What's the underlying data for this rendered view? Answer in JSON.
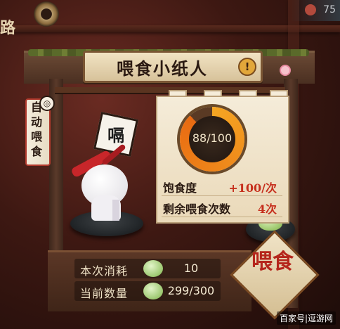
{
  "hud": {
    "corner_text": "路",
    "top_right_number": "75"
  },
  "panel": {
    "title": "喂食小纸人",
    "info_label": "!"
  },
  "auto_feed": {
    "label_chars": [
      "自",
      "动",
      "喂",
      "食"
    ]
  },
  "speech": {
    "text": "嗝"
  },
  "satiety": {
    "current": 88,
    "max": 100,
    "display": "88/100",
    "fraction": 0.88
  },
  "stats": {
    "satiety_label": "饱食度",
    "satiety_gain": "+100/次",
    "remaining_label": "剩余喂食次数",
    "remaining_value": "4次"
  },
  "cost": {
    "this_time_label": "本次消耗",
    "this_time_value": "10",
    "current_qty_label": "当前数量",
    "current_qty_value": "299/300"
  },
  "feed_button": {
    "label": "喂食"
  },
  "watermark": "百家号|逗游网",
  "colors": {
    "accent_orange": "#f5a623",
    "text_red": "#c62f1d",
    "paper": "#f5ecd9"
  }
}
